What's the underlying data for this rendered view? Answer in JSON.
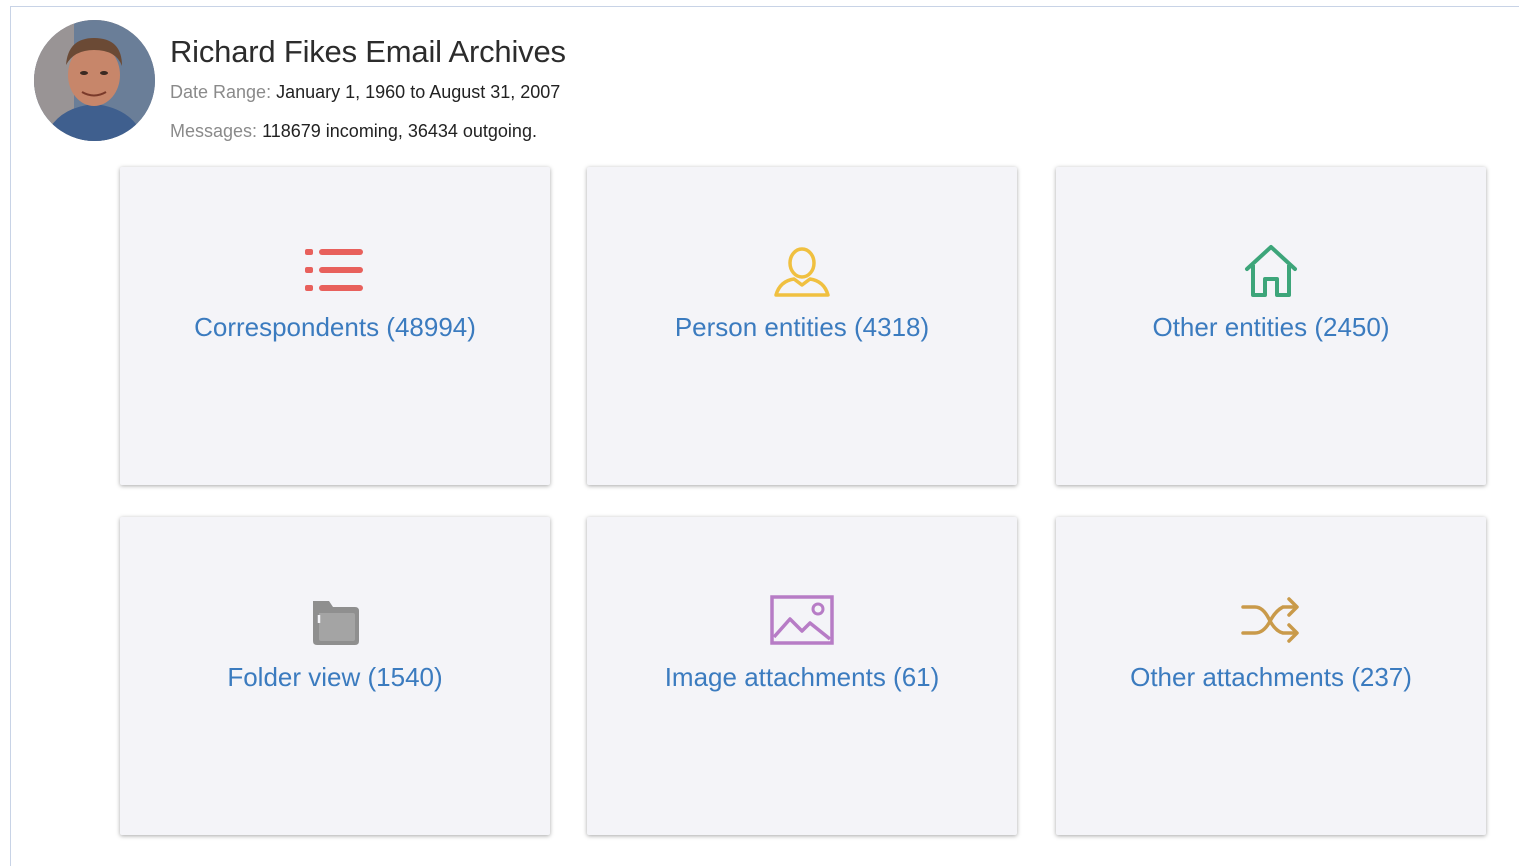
{
  "header": {
    "title": "Richard Fikes Email Archives",
    "date_range_label": "Date Range:",
    "date_range_value": "January 1, 1960 to August 31, 2007",
    "messages_label": "Messages:",
    "messages_value": "118679 incoming, 36434 outgoing."
  },
  "tiles": [
    {
      "label": "Correspondents (48994)",
      "icon": "list-icon",
      "color": "#e8605c"
    },
    {
      "label": "Person entities (4318)",
      "icon": "person-icon",
      "color": "#f0c040"
    },
    {
      "label": "Other entities (2450)",
      "icon": "home-icon",
      "color": "#3da57a"
    },
    {
      "label": "Folder view (1540)",
      "icon": "folder-icon",
      "color": "#8f8f8f"
    },
    {
      "label": "Image attachments (61)",
      "icon": "image-icon",
      "color": "#b77cc6"
    },
    {
      "label": "Other attachments (237)",
      "icon": "shuffle-icon",
      "color": "#c99a4a"
    }
  ],
  "colors": {
    "link": "#3b7bbf",
    "tile_bg": "#f4f4f8"
  }
}
